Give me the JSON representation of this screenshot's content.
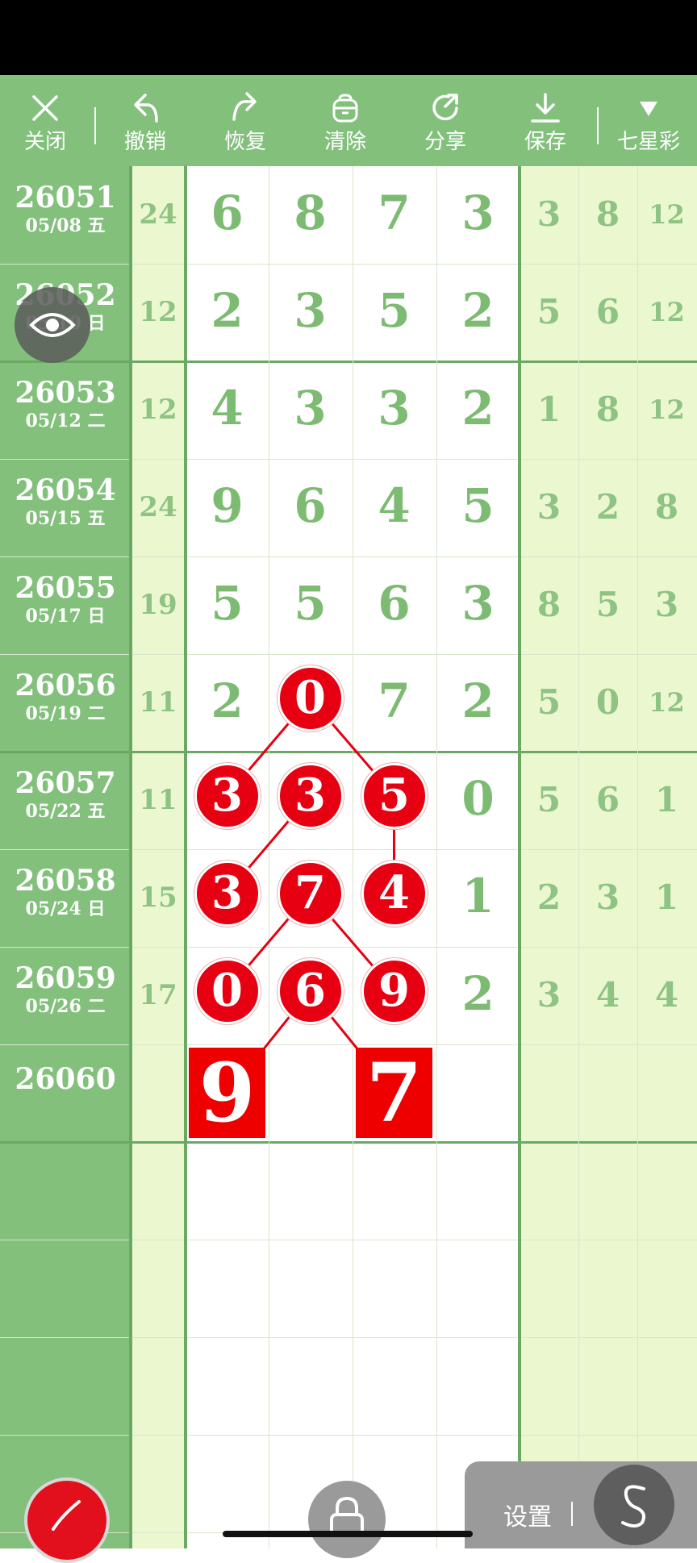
{
  "toolbar": {
    "close": {
      "label": "关闭",
      "icon": "close-icon"
    },
    "undo": {
      "label": "撤销",
      "icon": "undo-icon"
    },
    "redo": {
      "label": "恢复",
      "icon": "redo-icon"
    },
    "clear": {
      "label": "清除",
      "icon": "trash-icon"
    },
    "share": {
      "label": "分享",
      "icon": "share-icon"
    },
    "save": {
      "label": "保存",
      "icon": "download-icon"
    },
    "lottery": {
      "label": "七星彩",
      "icon": "triangle-down-icon"
    }
  },
  "rows": [
    {
      "issue": "26051",
      "date": "05/08 五",
      "sum": "24",
      "digits": [
        "6",
        "8",
        "7",
        "3"
      ],
      "right": [
        "3",
        "8",
        "12"
      ]
    },
    {
      "issue": "26052",
      "date": "05/10 日",
      "sum": "12",
      "digits": [
        "2",
        "3",
        "5",
        "2"
      ],
      "right": [
        "5",
        "6",
        "12"
      ]
    },
    {
      "issue": "26053",
      "date": "05/12 二",
      "sum": "12",
      "digits": [
        "4",
        "3",
        "3",
        "2"
      ],
      "right": [
        "1",
        "8",
        "12"
      ]
    },
    {
      "issue": "26054",
      "date": "05/15 五",
      "sum": "24",
      "digits": [
        "9",
        "6",
        "4",
        "5"
      ],
      "right": [
        "3",
        "2",
        "8"
      ]
    },
    {
      "issue": "26055",
      "date": "05/17 日",
      "sum": "19",
      "digits": [
        "5",
        "5",
        "6",
        "3"
      ],
      "right": [
        "8",
        "5",
        "3"
      ]
    },
    {
      "issue": "26056",
      "date": "05/19 二",
      "sum": "11",
      "digits": [
        "2",
        "0",
        "7",
        "2"
      ],
      "right": [
        "5",
        "0",
        "12"
      ]
    },
    {
      "issue": "26057",
      "date": "05/22 五",
      "sum": "11",
      "digits": [
        "3",
        "3",
        "5",
        "0"
      ],
      "right": [
        "5",
        "6",
        "1"
      ]
    },
    {
      "issue": "26058",
      "date": "05/24 日",
      "sum": "15",
      "digits": [
        "3",
        "7",
        "4",
        "1"
      ],
      "right": [
        "2",
        "3",
        "1"
      ]
    },
    {
      "issue": "26059",
      "date": "05/26 二",
      "sum": "17",
      "digits": [
        "0",
        "6",
        "9",
        "2"
      ],
      "right": [
        "3",
        "4",
        "4"
      ]
    },
    {
      "issue": "26060",
      "date": "",
      "sum": "",
      "digits": [
        "9",
        "",
        "7",
        ""
      ],
      "right": [
        "",
        "",
        ""
      ]
    }
  ],
  "marks": {
    "color": "#e60012",
    "circled": [
      [
        5,
        1
      ],
      [
        6,
        0
      ],
      [
        6,
        1
      ],
      [
        6,
        2
      ],
      [
        7,
        0
      ],
      [
        7,
        1
      ],
      [
        7,
        2
      ],
      [
        8,
        0
      ],
      [
        8,
        1
      ],
      [
        8,
        2
      ]
    ],
    "predicted": [
      [
        9,
        0
      ],
      [
        9,
        2
      ]
    ]
  },
  "floating": {
    "eye_button": "eye-icon",
    "pen_button": "pen-icon",
    "lock_button": "lock-icon",
    "settings_label": "设置",
    "s_button_icon": "s-curve-icon"
  },
  "colors": {
    "green": "#82c07c",
    "light_green": "#eaf7cf",
    "digit": "#7dbb73",
    "red": "#e60012"
  }
}
